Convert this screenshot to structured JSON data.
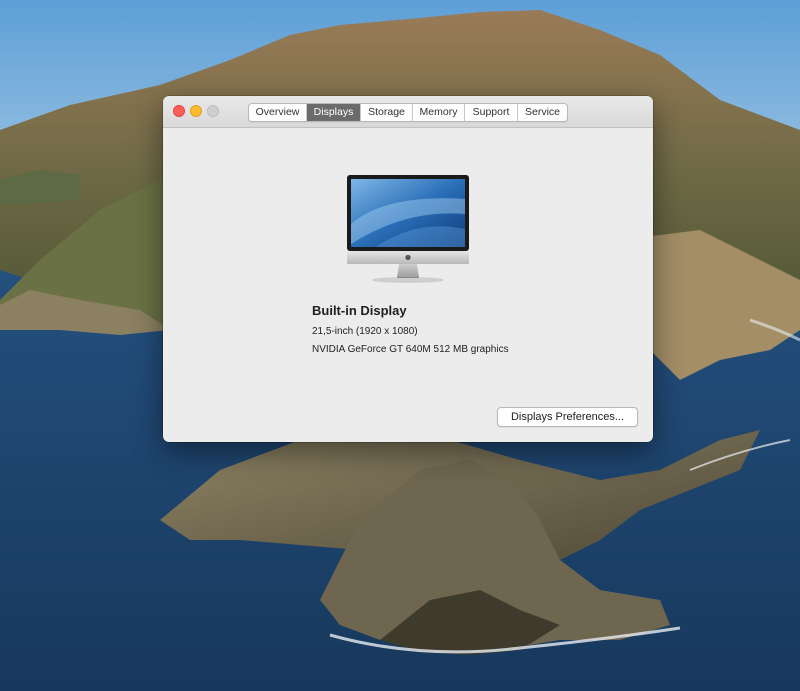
{
  "window": {
    "tabs": [
      {
        "label": "Overview",
        "active": false
      },
      {
        "label": "Displays",
        "active": true
      },
      {
        "label": "Storage",
        "active": false
      },
      {
        "label": "Memory",
        "active": false
      },
      {
        "label": "Support",
        "active": false
      },
      {
        "label": "Service",
        "active": false
      }
    ]
  },
  "display": {
    "name": "Built-in Display",
    "size_resolution": "21,5-inch (1920 x 1080)",
    "graphics": "NVIDIA GeForce GT 640M 512 MB graphics",
    "icon": "imac-icon"
  },
  "buttons": {
    "preferences_label": "Displays Preferences..."
  },
  "colors": {
    "close": "#fd5f57",
    "minimize": "#febb2e",
    "zoom_disabled": "#cfcfcf",
    "active_tab": "#6b6b6b",
    "window_bg": "#ececec"
  }
}
